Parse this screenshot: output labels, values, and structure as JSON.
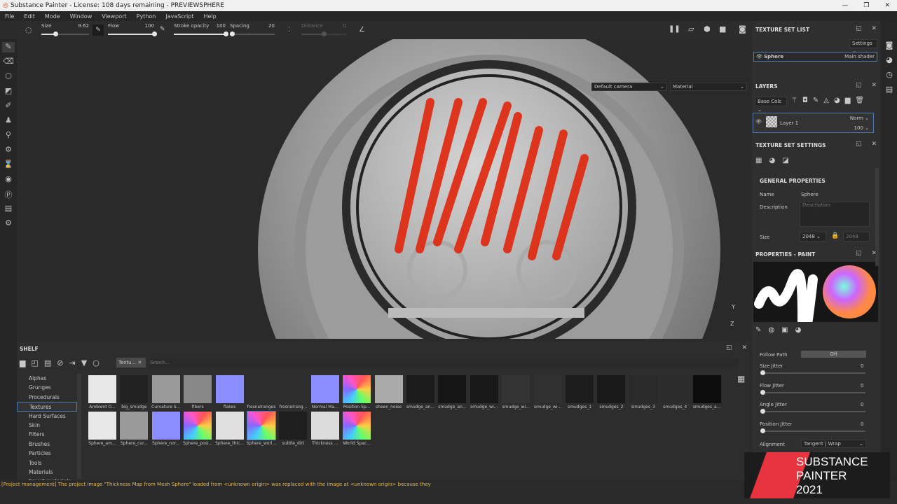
{
  "window": {
    "title": "Substance Painter - License: 108 days remaining - PREVIEWSPHERE",
    "min": "—",
    "max": "❐",
    "close": "✕"
  },
  "menu": [
    "File",
    "Edit",
    "Mode",
    "Window",
    "Viewport",
    "Python",
    "JavaScript",
    "Help"
  ],
  "toolbar": {
    "size": {
      "label": "Size",
      "value": "9.62",
      "fraction": 0.3
    },
    "flow": {
      "label": "Flow",
      "value": "100",
      "fraction": 1.0
    },
    "stroke_opacity": {
      "label": "Stroke opacity",
      "value": "100",
      "fraction": 1.0
    },
    "spacing": {
      "label": "Spacing",
      "value": "20",
      "fraction": 0.05
    },
    "distance": {
      "label": "Distance",
      "value": "0",
      "fraction": 0.5
    }
  },
  "viewport": {
    "camera": "Default camera",
    "mode": "Material",
    "axis_y": "Y",
    "axis_z": "Z"
  },
  "texture_set_list": {
    "title": "TEXTURE SET LIST",
    "settings": "Settings",
    "item_name": "Sphere",
    "item_shader": "Main shader"
  },
  "layers": {
    "title": "LAYERS",
    "channel": "Base Colc",
    "layer_name": "Layer 1",
    "blend": "Norm",
    "opacity": "100"
  },
  "texture_set_settings": {
    "title": "TEXTURE SET SETTINGS",
    "section": "GENERAL PROPERTIES",
    "name_label": "Name",
    "name_value": "Sphere",
    "desc_label": "Description",
    "desc_placeholder": "Description",
    "size_label": "Size",
    "size_value": "2048",
    "size_value2": "2048"
  },
  "properties_paint": {
    "title": "PROPERTIES - PAINT",
    "follow_path_label": "Follow Path",
    "follow_path_value": "Off",
    "jitters": [
      {
        "label": "Size Jitter",
        "value": "0"
      },
      {
        "label": "Flow Jitter",
        "value": "0"
      },
      {
        "label": "Angle Jitter",
        "value": "0"
      },
      {
        "label": "Position Jitter",
        "value": "0"
      }
    ],
    "alignment_label": "Alignment",
    "alignment_value": "Tangent | Wrap"
  },
  "shelf": {
    "title": "SHELF",
    "filter_tag": "Textu...",
    "search_placeholder": "Search...",
    "categories": [
      "Alphas",
      "Grunges",
      "Procedurals",
      "Textures",
      "Hard Surfaces",
      "Skin",
      "Filters",
      "Brushes",
      "Particles",
      "Tools",
      "Materials",
      "Smart materials"
    ],
    "selected_category": "Textures",
    "row1": [
      {
        "name": "Ambient O...",
        "fill": "#e8e8e8"
      },
      {
        "name": "big_smudge",
        "fill": "#222"
      },
      {
        "name": "Curvature S...",
        "fill": "#9a9a9a"
      },
      {
        "name": "fibers",
        "fill": "#888"
      },
      {
        "name": "flakes",
        "fill": "#8a8cff"
      },
      {
        "name": "fresnelranges",
        "fill": "#2d2d2d"
      },
      {
        "name": "fresnelrang...",
        "fill": "#2d2d2d"
      },
      {
        "name": "Normal Ma...",
        "fill": "#8a8cff"
      },
      {
        "name": "Position Sp...",
        "fill": "conic"
      },
      {
        "name": "sheen_noise",
        "fill": "#aaa"
      },
      {
        "name": "smudge_an...",
        "fill": "#1c1c1c"
      },
      {
        "name": "smudge_an...",
        "fill": "#151515"
      },
      {
        "name": "smudge_wi...",
        "fill": "#181818"
      },
      {
        "name": "smudge_wi...",
        "fill": "#333"
      },
      {
        "name": "smudge_wi...",
        "fill": "#303030"
      },
      {
        "name": "smudges_1",
        "fill": "#1d1d1d"
      },
      {
        "name": "smudges_2",
        "fill": "#1a1a1a"
      },
      {
        "name": "smudges_3",
        "fill": "#2a2a2a"
      },
      {
        "name": "smudges_4",
        "fill": "#2c2c2c"
      },
      {
        "name": "smudges_a...",
        "fill": "#0c0c0c"
      }
    ],
    "row2": [
      {
        "name": "Sphere_am...",
        "fill": "#e8e8e8"
      },
      {
        "name": "Sphere_cur...",
        "fill": "#9a9a9a"
      },
      {
        "name": "Sphere_nor...",
        "fill": "#8a8cff"
      },
      {
        "name": "Sphere_posi...",
        "fill": "conic"
      },
      {
        "name": "Sphere_thic...",
        "fill": "#e0e0e0"
      },
      {
        "name": "Sphere_worl...",
        "fill": "conic",
        "selected": true
      },
      {
        "name": "subtle_dirt",
        "fill": "#1e1e1e"
      },
      {
        "name": "Thickness ...",
        "fill": "#dcdcdc"
      },
      {
        "name": "World Spac...",
        "fill": "conic"
      }
    ]
  },
  "status": {
    "message": "[Project management] The project image \"Thickness Map from Mesh Sphere\" loaded from <unknown origin> was replaced with the image at <unknown origin> because they"
  },
  "logo": {
    "line1": "SUBSTANCE",
    "line2": "PAINTER",
    "line3": "2021",
    "accent": "#e8343e"
  },
  "colors": {
    "accent_blue": "#4e7ab0",
    "paint_red": "#e02a10",
    "status_text": "#e8b850"
  }
}
